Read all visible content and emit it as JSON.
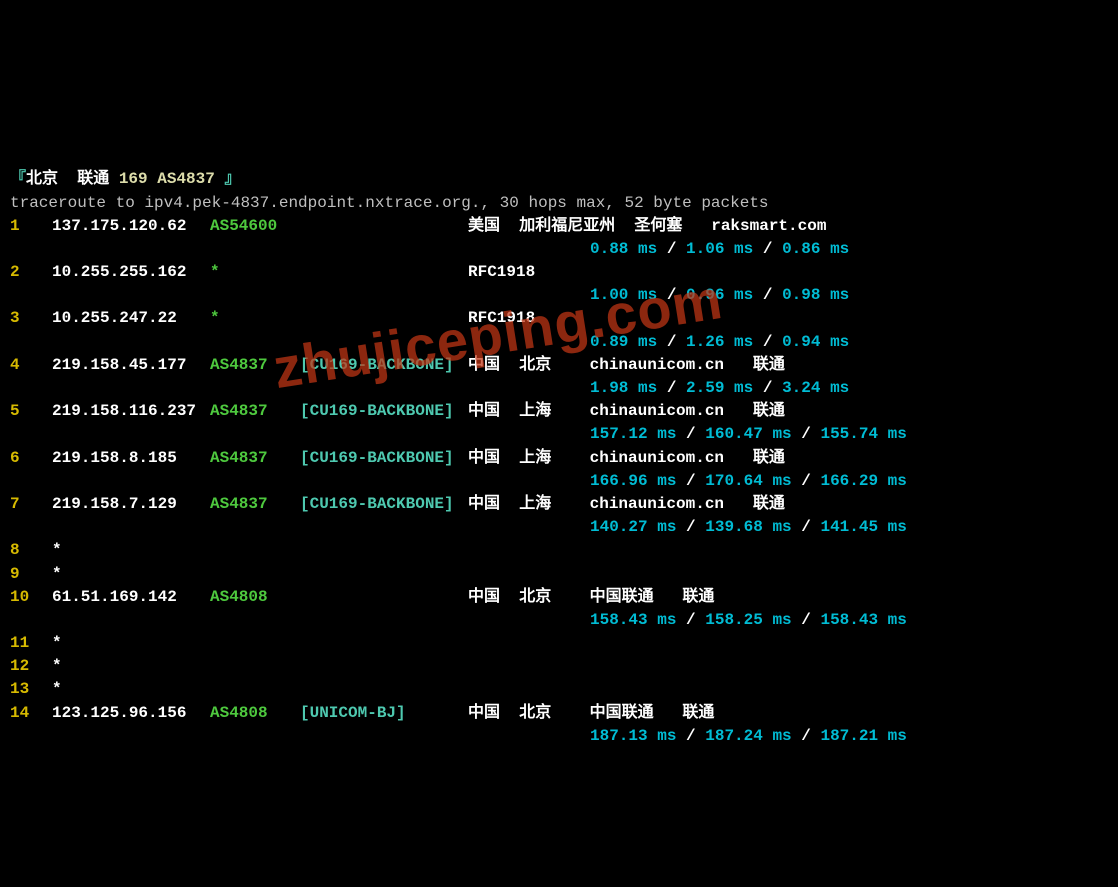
{
  "header": {
    "open": "『",
    "location": "北京  联通 ",
    "asn": "169 AS4837",
    "close": " 』"
  },
  "cmdline": "traceroute to ipv4.pek-4837.endpoint.nxtrace.org., 30 hops max, 52 byte packets",
  "watermark": "zhujiceping.com",
  "hops": [
    {
      "n": "1",
      "ip": "137.175.120.62",
      "asn": "AS54600",
      "tag": "",
      "geo": "美国  加利福尼亚州  圣何塞   raksmart.com",
      "lat": [
        "0.88 ms",
        "1.06 ms",
        "0.86 ms"
      ]
    },
    {
      "n": "2",
      "ip": "10.255.255.162",
      "asn": "*",
      "tag": "",
      "geo": "RFC1918",
      "lat": [
        "1.00 ms",
        "0.96 ms",
        "0.98 ms"
      ]
    },
    {
      "n": "3",
      "ip": "10.255.247.22",
      "asn": "*",
      "tag": "",
      "geo": "RFC1918",
      "lat": [
        "0.89 ms",
        "1.26 ms",
        "0.94 ms"
      ]
    },
    {
      "n": "4",
      "ip": "219.158.45.177",
      "asn": "AS4837",
      "tag": "[CU169-BACKBONE]",
      "geo": "中国  北京    chinaunicom.cn   联通",
      "lat": [
        "1.98 ms",
        "2.59 ms",
        "3.24 ms"
      ]
    },
    {
      "n": "5",
      "ip": "219.158.116.237",
      "asn": "AS4837",
      "tag": "[CU169-BACKBONE]",
      "geo": "中国  上海    chinaunicom.cn   联通",
      "lat": [
        "157.12 ms",
        "160.47 ms",
        "155.74 ms"
      ]
    },
    {
      "n": "6",
      "ip": "219.158.8.185",
      "asn": "AS4837",
      "tag": "[CU169-BACKBONE]",
      "geo": "中国  上海    chinaunicom.cn   联通",
      "lat": [
        "166.96 ms",
        "170.64 ms",
        "166.29 ms"
      ]
    },
    {
      "n": "7",
      "ip": "219.158.7.129",
      "asn": "AS4837",
      "tag": "[CU169-BACKBONE]",
      "geo": "中国  上海    chinaunicom.cn   联通",
      "lat": [
        "140.27 ms",
        "139.68 ms",
        "141.45 ms"
      ]
    },
    {
      "n": "8",
      "ip": "*",
      "asn": "",
      "tag": "",
      "geo": "",
      "lat": null
    },
    {
      "n": "9",
      "ip": "*",
      "asn": "",
      "tag": "",
      "geo": "",
      "lat": null
    },
    {
      "n": "10",
      "ip": "61.51.169.142",
      "asn": "AS4808",
      "tag": "",
      "geo": "中国  北京    中国联通   联通",
      "lat": [
        "158.43 ms",
        "158.25 ms",
        "158.43 ms"
      ]
    },
    {
      "n": "11",
      "ip": "*",
      "asn": "",
      "tag": "",
      "geo": "",
      "lat": null
    },
    {
      "n": "12",
      "ip": "*",
      "asn": "",
      "tag": "",
      "geo": "",
      "lat": null
    },
    {
      "n": "13",
      "ip": "*",
      "asn": "",
      "tag": "",
      "geo": "",
      "lat": null
    },
    {
      "n": "14",
      "ip": "123.125.96.156",
      "asn": "AS4808",
      "tag": "[UNICOM-BJ]",
      "geo": "中国  北京    中国联通   联通",
      "lat": [
        "187.13 ms",
        "187.24 ms",
        "187.21 ms"
      ]
    }
  ]
}
